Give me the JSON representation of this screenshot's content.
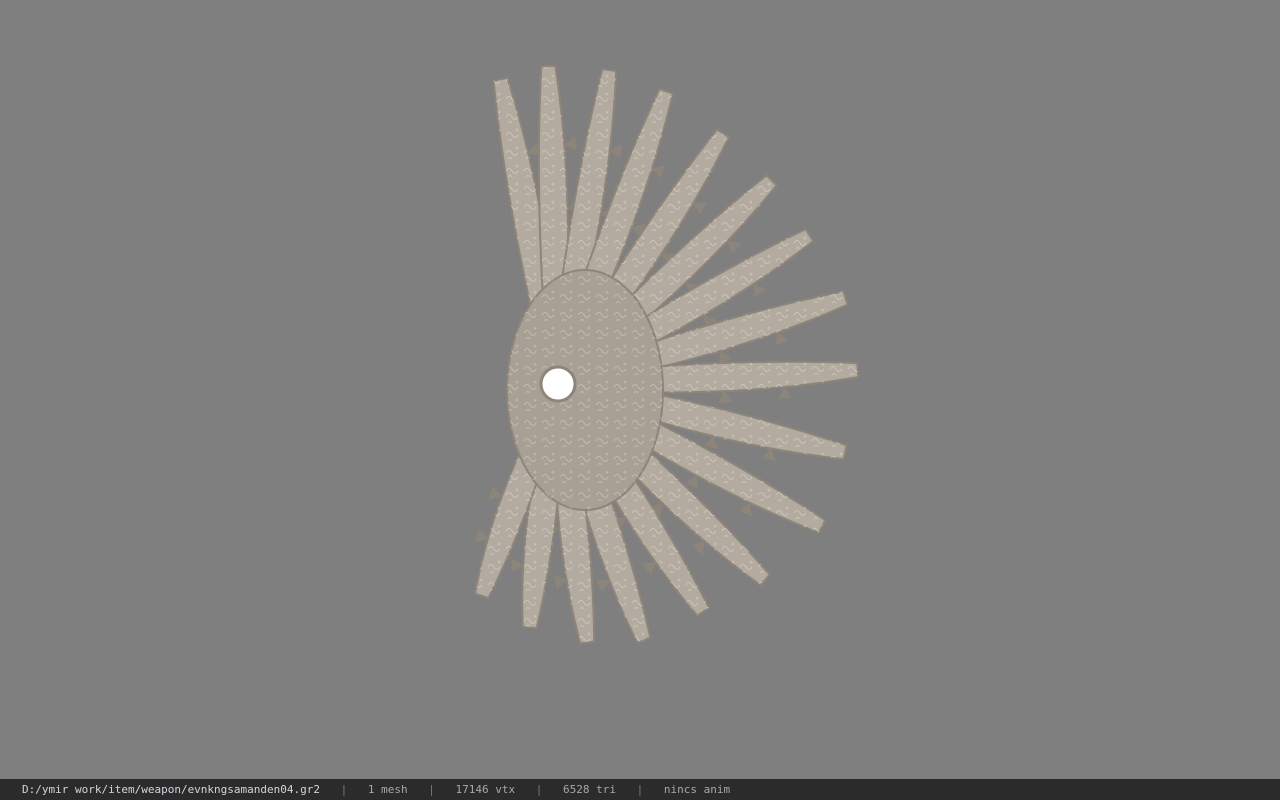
{
  "viewer": {
    "background_color": "#7f7f7f",
    "model_color": "#b4aba0",
    "model_shadow_color": "#8e857a",
    "model_pattern_color": "#e6e1da"
  },
  "status_bar": {
    "background_color": "#2b2b2b",
    "file_path": "D:/ymir work/item/weapon/evnkngsamanden04.gr2",
    "separator": "|",
    "mesh_count": "1 mesh",
    "vertex_count": "17146 vtx",
    "triangle_count": "6528 tri",
    "anim_status": "nincs anim"
  }
}
